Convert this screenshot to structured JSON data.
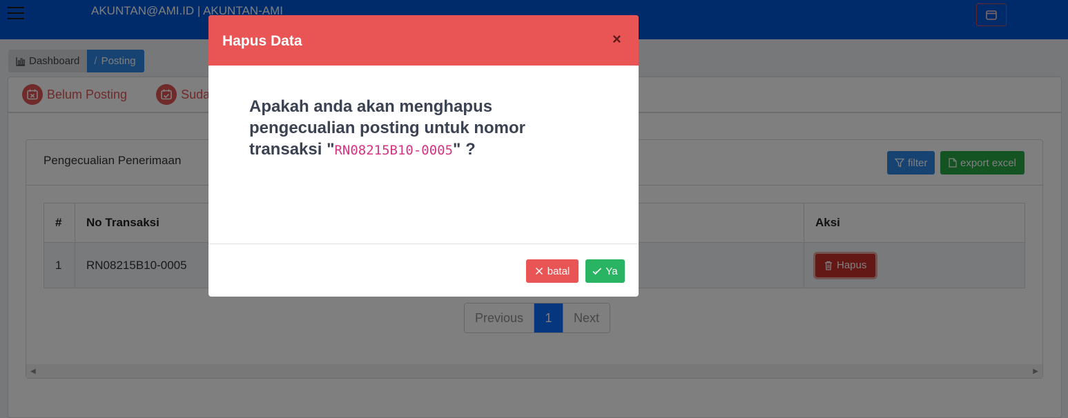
{
  "header": {
    "user_label": "AKUNTAN@AMI.ID | AKUNTAN-AMI"
  },
  "breadcrumb": {
    "items": [
      "Dashboard",
      "Posting"
    ],
    "separator": "/"
  },
  "tabs": [
    "Belum Posting",
    "Sudah"
  ],
  "panel": {
    "title": "Pengecualian Penerimaan",
    "filter_label": "filter",
    "export_label": "export excel"
  },
  "table": {
    "headers": [
      "#",
      "No Transaksi",
      "Aksi"
    ],
    "rows": [
      {
        "no": "1",
        "no_transaksi": "RN08215B10-0005",
        "action_label": "Hapus"
      }
    ]
  },
  "pagination": {
    "previous": "Previous",
    "current": "1",
    "next": "Next"
  },
  "modal": {
    "title": "Hapus Data",
    "close": "×",
    "message_prefix": "Apakah anda akan menghapus pengecualian posting untuk nomor transaksi \"",
    "code": "RN08215B10-0005",
    "message_suffix": "\" ?",
    "cancel_label": "batal",
    "confirm_label": "Ya"
  },
  "colors": {
    "topbar": "#0056d6",
    "danger": "#e95555",
    "success": "#28b463",
    "primary": "#2e86e6"
  },
  "icons": [
    "hamburger-icon",
    "window-icon",
    "chart-icon",
    "calendar-x-icon",
    "calendar-check-icon",
    "filter-icon",
    "file-icon",
    "trash-icon",
    "x-icon",
    "check-icon",
    "close-icon"
  ]
}
